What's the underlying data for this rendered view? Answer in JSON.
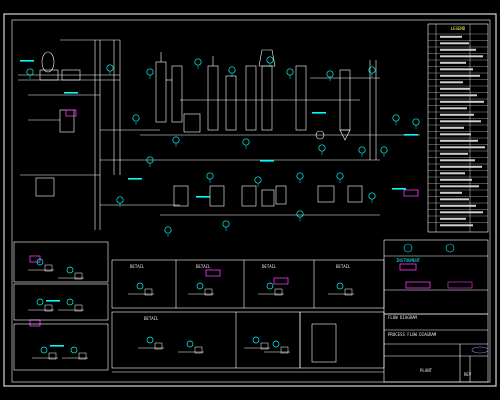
{
  "drawing": {
    "title_block_main": "FLOW DIAGRAM",
    "title_block_sub": "PROCESS FLOW DIAGRAM",
    "project_text": "PLANT",
    "legend_header": "LEGEND",
    "legend_box_label": "INSTRUMENT",
    "revision_box": "REV",
    "detail_titles": [
      "DETAIL",
      "DETAIL",
      "DETAIL",
      "DETAIL",
      "DETAIL"
    ]
  },
  "colors": {
    "background": "#000000",
    "frame": "#ffffff",
    "process_line": "#ffffff",
    "instrument": "#00ffff",
    "label": "#ffff55",
    "highlight": "#ff33ff",
    "equipment": "#e8e8e8"
  }
}
